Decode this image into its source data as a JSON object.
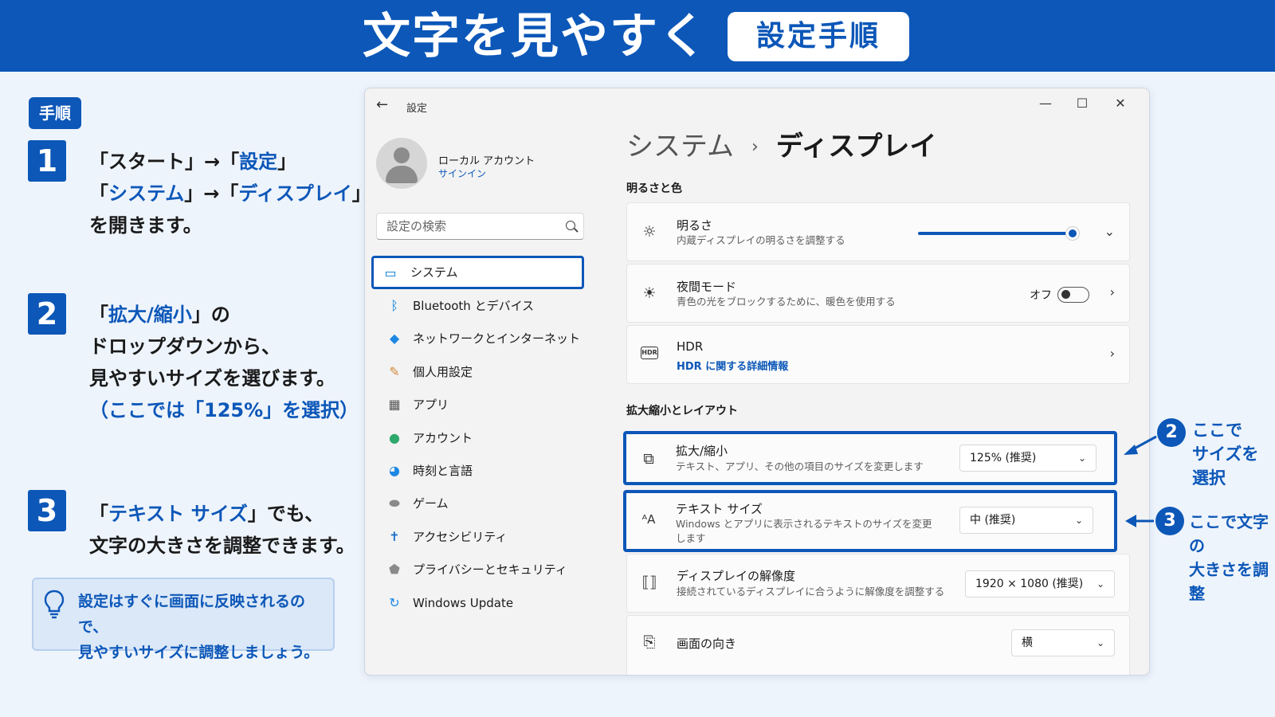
{
  "banner": {
    "title": "文字を見やすく",
    "badge": "設定手順"
  },
  "instructions": {
    "tag": "手順",
    "steps": [
      {
        "number": "1",
        "lines": [
          [
            {
              "t": "「スタート」→「",
              "hl": false
            },
            {
              "t": "設定",
              "hl": true
            },
            {
              "t": "」",
              "hl": false
            }
          ],
          [
            {
              "t": "「",
              "hl": false
            },
            {
              "t": "システム",
              "hl": true
            },
            {
              "t": "」→「",
              "hl": false
            },
            {
              "t": "ディスプレイ",
              "hl": true
            },
            {
              "t": "」",
              "hl": false
            }
          ],
          [
            {
              "t": "を開きます。",
              "hl": false
            }
          ]
        ]
      },
      {
        "number": "2",
        "lines": [
          [
            {
              "t": "「",
              "hl": false
            },
            {
              "t": "拡大/縮小",
              "hl": true
            },
            {
              "t": "」の",
              "hl": false
            }
          ],
          [
            {
              "t": "ドロップダウンから、",
              "hl": false
            }
          ],
          [
            {
              "t": "見やすいサイズを選びます。",
              "hl": false
            }
          ],
          [
            {
              "t": "（ここでは「125%」を選択）",
              "hl": true
            }
          ]
        ]
      },
      {
        "number": "3",
        "lines": [
          [
            {
              "t": "「",
              "hl": false
            },
            {
              "t": "テキスト サイズ",
              "hl": true
            },
            {
              "t": "」でも、",
              "hl": false
            }
          ],
          [
            {
              "t": "文字の大きさを調整できます。",
              "hl": false
            }
          ]
        ]
      }
    ],
    "tip": {
      "line1": "設定はすぐに画面に反映されるので、",
      "line2": "見やすいサイズに調整しましょう。"
    }
  },
  "window": {
    "title": "設定",
    "controls": {
      "minimize": "—",
      "maximize": "☐",
      "close": "✕"
    },
    "account": {
      "name": "ローカル アカウント",
      "signin": "サインイン"
    },
    "search_placeholder": "設定の検索",
    "nav": [
      {
        "label": "システム",
        "icon": "monitor-icon",
        "color": "#0078d4",
        "active": true
      },
      {
        "label": "Bluetooth とデバイス",
        "icon": "bluetooth-icon",
        "color": "#0078d4"
      },
      {
        "label": "ネットワークとインターネット",
        "icon": "wifi-icon",
        "color": "#1e88e5"
      },
      {
        "label": "個人用設定",
        "icon": "brush-icon",
        "color": "#d08a3a"
      },
      {
        "label": "アプリ",
        "icon": "apps-icon",
        "color": "#555555"
      },
      {
        "label": "アカウント",
        "icon": "person-icon",
        "color": "#2ea86b"
      },
      {
        "label": "時刻と言語",
        "icon": "globe-clock-icon",
        "color": "#1e88e5"
      },
      {
        "label": "ゲーム",
        "icon": "gamepad-icon",
        "color": "#8a8a8a"
      },
      {
        "label": "アクセシビリティ",
        "icon": "accessibility-icon",
        "color": "#1a73c8"
      },
      {
        "label": "プライバシーとセキュリティ",
        "icon": "shield-icon",
        "color": "#8a8a8a"
      },
      {
        "label": "Windows Update",
        "icon": "update-icon",
        "color": "#1e88e5"
      }
    ],
    "breadcrumb": {
      "parent": "システム",
      "separator": "›",
      "current": "ディスプレイ"
    },
    "sections": {
      "brightness_color": "明るさと色",
      "scale_layout": "拡大縮小とレイアウト"
    },
    "brightness": {
      "title": "明るさ",
      "subtitle": "内蔵ディスプレイの明るさを調整する",
      "level_fraction": 0.97
    },
    "night_mode": {
      "title": "夜間モード",
      "subtitle": "青色の光をブロックするために、暖色を使用する",
      "state": "オフ"
    },
    "hdr": {
      "title": "HDR",
      "link": "HDR に関する詳細情報"
    },
    "scale": {
      "title": "拡大/縮小",
      "subtitle": "テキスト、アプリ、その他の項目のサイズを変更します",
      "value": "125% (推奨)"
    },
    "text_size": {
      "title": "テキスト サイズ",
      "subtitle_line1": "Windows とアプリに表示されるテキストのサイズを変更",
      "subtitle_line2": "します",
      "value": "中 (推奨)"
    },
    "resolution": {
      "title": "ディスプレイの解像度",
      "subtitle": "接続されているディスプレイに合うように解像度を調整する",
      "value": "1920 × 1080 (推奨)"
    },
    "orientation": {
      "title": "画面の向き",
      "value": "横"
    }
  },
  "callouts": {
    "c2": {
      "number": "2",
      "line1": "ここで",
      "line2": "サイズを",
      "line3": "選択"
    },
    "c3": {
      "number": "3",
      "line1": "ここで文字の",
      "line2": "大きさを調整"
    }
  },
  "colors": {
    "accent": "#0c57b8",
    "background": "#eef4fc"
  }
}
